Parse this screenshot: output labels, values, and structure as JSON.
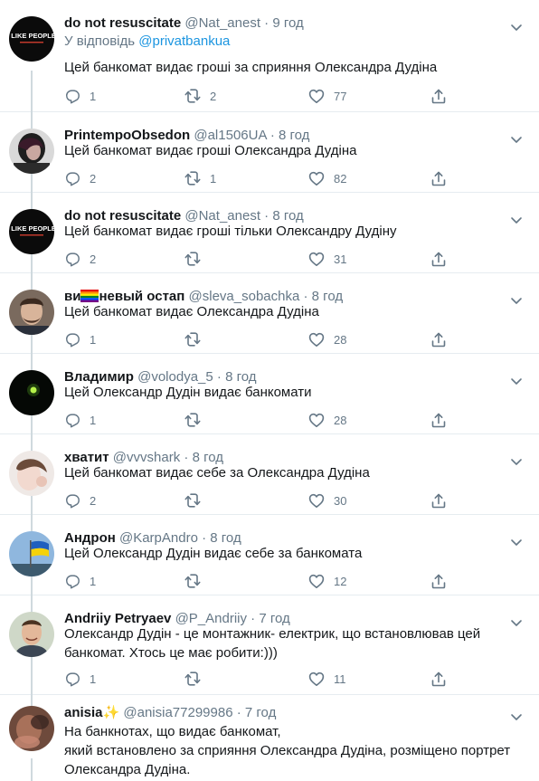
{
  "tweets": [
    {
      "name": "do not resuscitate",
      "handle": "@Nat_anest",
      "time": "9 год",
      "reply_prefix": "У відповідь",
      "reply_mention": "@privatbankua",
      "text": "Цей банкомат видає гроші за сприяння Олександра Дудіна",
      "counts": {
        "reply": "1",
        "retweet": "2",
        "like": "77"
      },
      "avatar": "i-like-people-avatar",
      "avatar_text": "I LIKE PEOPLE"
    },
    {
      "name": "PrintempoObsedon",
      "handle": "@al1506UA",
      "time": "8 год",
      "text": "Цей банкомат видає гроші Олександра Дудіна",
      "counts": {
        "reply": "2",
        "retweet": "1",
        "like": "82"
      },
      "avatar": "woman-portrait-avatar"
    },
    {
      "name": "do not resuscitate",
      "handle": "@Nat_anest",
      "time": "8 год",
      "text": "Цей банкомат видає гроші тільки Олександру Дудіну",
      "counts": {
        "reply": "2",
        "retweet": "",
        "like": "31"
      },
      "avatar": "i-like-people-avatar",
      "avatar_text": "I LIKE PEOPLE"
    },
    {
      "name_prefix": "ви",
      "name_suffix": "невый остап",
      "handle": "@sleva_sobachka",
      "time": "8 год",
      "text": "Цей банкомат видає Олександра Дудіна",
      "counts": {
        "reply": "1",
        "retweet": "",
        "like": "28"
      },
      "avatar": "man-portrait-avatar"
    },
    {
      "name": "Владимир",
      "handle": "@volodya_5",
      "time": "8 год",
      "text": "Цей Олександр Дудін видає банкомати",
      "counts": {
        "reply": "1",
        "retweet": "",
        "like": "28"
      },
      "avatar": "green-light-avatar"
    },
    {
      "name": "хватит",
      "handle": "@vvvshark",
      "time": "8 год",
      "text": "Цей банкомат видає себе за Олександра Дудіна",
      "counts": {
        "reply": "2",
        "retweet": "",
        "like": "30"
      },
      "avatar": "girl-portrait-avatar"
    },
    {
      "name": "Андрон",
      "handle": "@KarpAndro",
      "time": "8 год",
      "text": "Цей Олександр Дудін видає себе за банкомата",
      "counts": {
        "reply": "1",
        "retweet": "",
        "like": "12"
      },
      "avatar": "ukraine-flag-avatar"
    },
    {
      "name": "Andriiy Petryaev",
      "handle": "@P_Andriiy",
      "time": "7 год",
      "text": "Олександр Дудін - це монтажник- електрик, що встановлював цей\nбанкомат. Хтось це має робити:)))",
      "counts": {
        "reply": "1",
        "retweet": "",
        "like": "11"
      },
      "avatar": "smiling-man-avatar"
    },
    {
      "name": "anisia",
      "handle": "@anisia77299986",
      "time": "7 год",
      "text": "На банкнотах, що видає банкомат,\nякий встановлено за сприяння Олександра Дудіна, розміщено портрет\nОлександра Дудіна.",
      "counts": {
        "reply": "",
        "retweet": "",
        "like": ""
      },
      "avatar": "blurred-portrait-avatar"
    }
  ],
  "colors": {
    "text": "#14171a",
    "secondary": "#657786",
    "link": "#1b95e0",
    "divider": "#e6ecf0",
    "thread_line": "#cfd9de"
  },
  "emoji": {
    "rainbow_flag": "rainbow-flag-emoji",
    "sparkles": "✨"
  }
}
